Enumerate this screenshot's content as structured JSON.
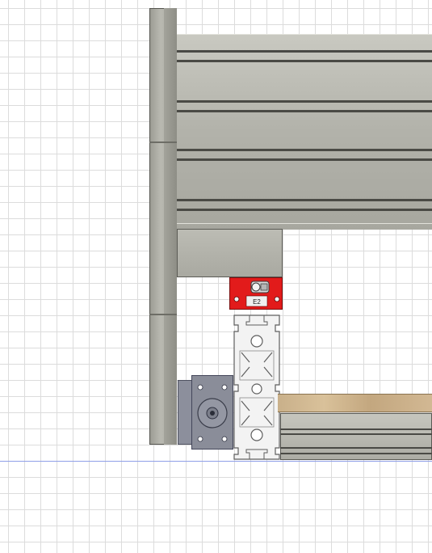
{
  "viewport": {
    "label": "cad-viewport"
  },
  "limit_switch": {
    "label": "E2"
  },
  "colors": {
    "grid": "#dcdcdc",
    "axis": "#8f9fe8",
    "aluminum": "#b2b2aa",
    "motor": "#8a8d99",
    "switch": "#e21b1b",
    "wood": "#d2b893"
  }
}
